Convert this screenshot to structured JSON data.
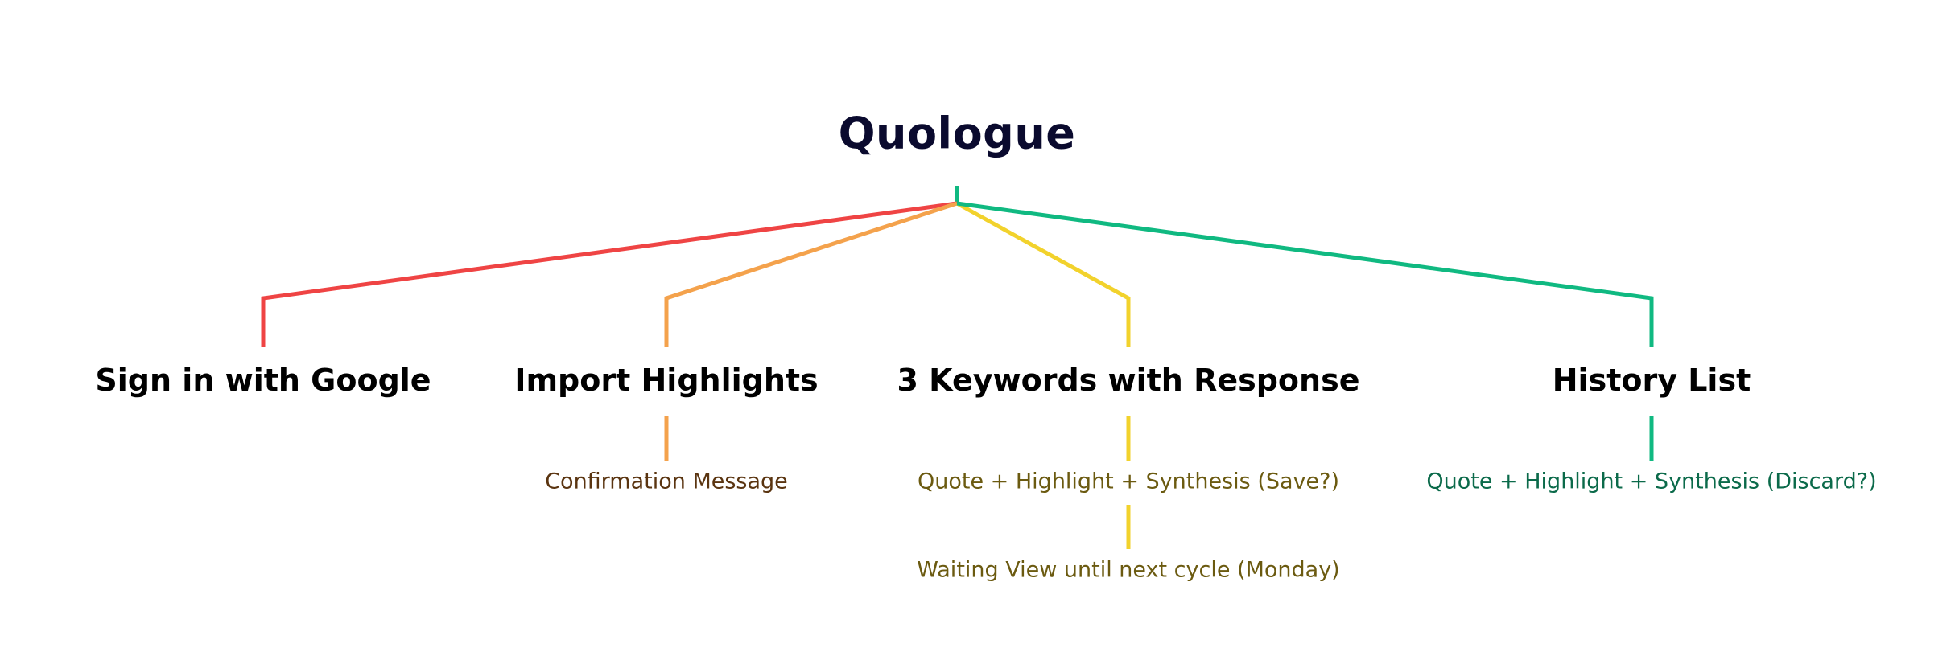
{
  "root": {
    "label": "Quologue",
    "color": "#0a0a2e"
  },
  "branches": [
    {
      "id": "sign-in",
      "label": "Sign in with Google",
      "line_color": "#ef4444",
      "text_color": "#000000",
      "children": []
    },
    {
      "id": "import",
      "label": "Import Highlights",
      "line_color": "#f4a24c",
      "text_color": "#000000",
      "children": [
        {
          "label": "Confirmation Message",
          "text_color": "#5a3410"
        }
      ]
    },
    {
      "id": "keywords",
      "label": "3 Keywords with Response",
      "line_color": "#f2d22c",
      "text_color": "#000000",
      "children": [
        {
          "label": "Quote + Highlight + Synthesis (Save?)",
          "text_color": "#6b5a10"
        },
        {
          "label": "Waiting View until next cycle (Monday)",
          "text_color": "#6b5a10"
        }
      ]
    },
    {
      "id": "history",
      "label": "History List",
      "line_color": "#10b981",
      "text_color": "#000000",
      "children": [
        {
          "label": "Quote + Highlight + Synthesis (Discard?)",
          "text_color": "#0b6a4a"
        }
      ]
    }
  ]
}
